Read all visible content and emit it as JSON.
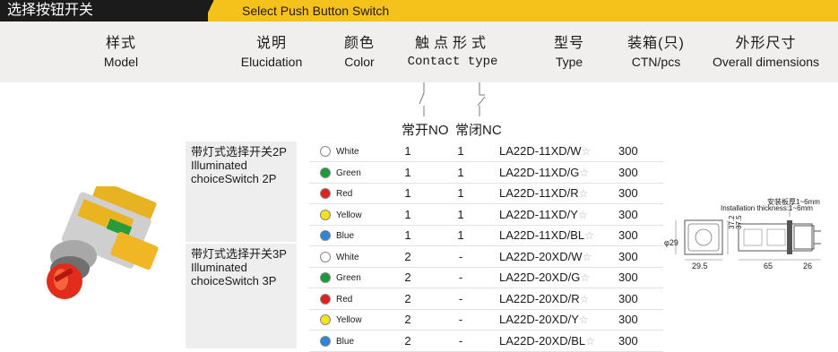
{
  "banner": {
    "title_cn": "选择按钮开关",
    "title_en": "Select Push Button Switch"
  },
  "header": {
    "model": {
      "cn": "样式",
      "en": "Model"
    },
    "elucidation": {
      "cn": "说明",
      "en": "Elucidation"
    },
    "color": {
      "cn": "颜色",
      "en": "Color"
    },
    "contact": {
      "cn": "触点形式",
      "en": "Contact type"
    },
    "type": {
      "cn": "型号",
      "en": "Type"
    },
    "ctn": {
      "cn": "装箱(只)",
      "en": "CTN/pcs"
    },
    "dims": {
      "cn": "外形尺寸",
      "en": "Overall dimensions"
    }
  },
  "contact_labels": {
    "no": "常开NO",
    "nc": "常闭NC"
  },
  "groups": [
    {
      "desc": "带灯式选择开关2P Illuminated choiceSwitch 2P"
    },
    {
      "desc": "带灯式选择开关3P Illuminated choiceSwitch 3P"
    }
  ],
  "rows": [
    {
      "color_name": "White",
      "color_hex": "#ffffff",
      "no": "1",
      "nc": "1",
      "type": "LA22D-11XD/W",
      "ctn": "300"
    },
    {
      "color_name": "Green",
      "color_hex": "#1a9a3a",
      "no": "1",
      "nc": "1",
      "type": "LA22D-11XD/G",
      "ctn": "300"
    },
    {
      "color_name": "Red",
      "color_hex": "#e0201e",
      "no": "1",
      "nc": "1",
      "type": "LA22D-11XD/R",
      "ctn": "300"
    },
    {
      "color_name": "Yellow",
      "color_hex": "#f4e21a",
      "no": "1",
      "nc": "1",
      "type": "LA22D-11XD/Y",
      "ctn": "300"
    },
    {
      "color_name": "Blue",
      "color_hex": "#2a86d6",
      "no": "1",
      "nc": "1",
      "type": "LA22D-11XD/BL",
      "ctn": "300"
    },
    {
      "color_name": "White",
      "color_hex": "#ffffff",
      "no": "2",
      "nc": "-",
      "type": "LA22D-20XD/W",
      "ctn": "300"
    },
    {
      "color_name": "Green",
      "color_hex": "#1a9a3a",
      "no": "2",
      "nc": "-",
      "type": "LA22D-20XD/G",
      "ctn": "300"
    },
    {
      "color_name": "Red",
      "color_hex": "#e0201e",
      "no": "2",
      "nc": "-",
      "type": "LA22D-20XD/R",
      "ctn": "300"
    },
    {
      "color_name": "Yellow",
      "color_hex": "#f4e21a",
      "no": "2",
      "nc": "-",
      "type": "LA22D-20XD/Y",
      "ctn": "300"
    },
    {
      "color_name": "Blue",
      "color_hex": "#2a86d6",
      "no": "2",
      "nc": "-",
      "type": "LA22D-20XD/BL",
      "ctn": "300"
    }
  ],
  "star_symbol": "☆",
  "dimensions": {
    "install_cn": "安装板厚1~6mm",
    "install_en": "Installation thickness:1~6mm",
    "diameter": "φ29",
    "width_front": "29.5",
    "height_a": "37.2",
    "height_b": "37.5",
    "length_body": "65",
    "length_rear": "26"
  },
  "colors": {
    "banner_accent": "#f5c21b",
    "banner_dark": "#1b1b1b",
    "header_bg": "#f0efed"
  }
}
